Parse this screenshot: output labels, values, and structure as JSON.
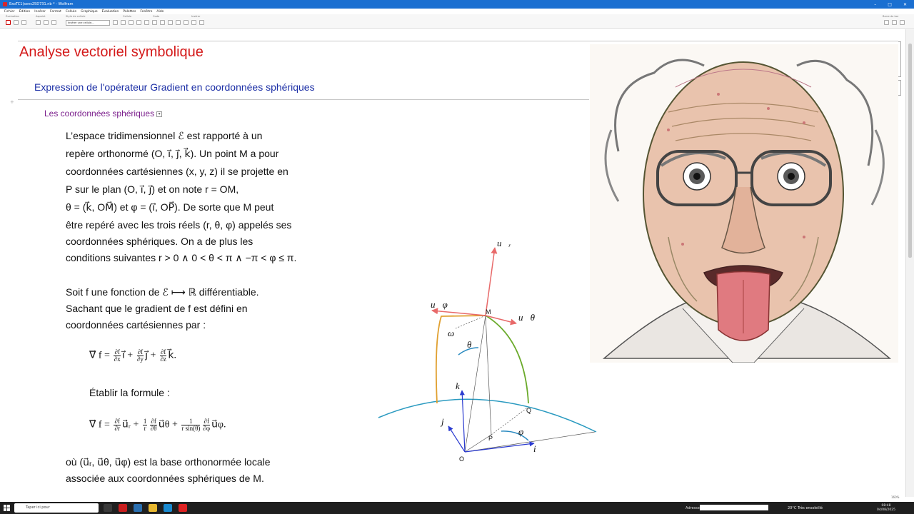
{
  "window": {
    "title": "ExoTC1(sens25D731.nb * - Wolfram",
    "controls": [
      "–",
      "□",
      "✕"
    ]
  },
  "menu": [
    "Fichier",
    "Édition",
    "Insérer",
    "Format",
    "Cellule",
    "Graphique",
    "Évaluation",
    "Palettes",
    "Fenêtre",
    "Aide"
  ],
  "toolbar": {
    "groups": [
      "Évaluation",
      "Aspoint",
      "Style de cellule",
      "Cellule",
      "Code",
      "Insérer"
    ],
    "style_select": "Insérer une cellule...",
    "right_label": "Barre de bor"
  },
  "notebook": {
    "title": "Analyse vectoriel symbolique",
    "section": "Expression de l'opérateur Gradient en coordonnées sphériques",
    "subsection": "Les coordonnées sphériques",
    "para1": [
      "L’espace tridimensionnel ℰ est rapporté à un",
      "repère orthonormé (O, i⃗, j⃗, k⃗). Un point M a pour",
      "coordonnées cartésiennes (x, y, z) il se projette en",
      "P sur le plan (O, i⃗, j⃗) et on note r = OM,",
      "θ = (k⃗, OM⃗) et φ = (i⃗, OP⃗). De sorte que M peut",
      "être repéré avec les trois réels (r, θ, φ) appelés ses",
      "coordonnées sphériques. On a de plus les",
      "conditions suivantes r > 0 ∧ 0 < θ < π ∧ −π < φ ≤ π."
    ],
    "para2": [
      "Soit f une fonction de ℰ ⟼ ℝ différentiable.",
      "Sachant que le gradient de f est défini en",
      "coordonnées cartésiennes par :"
    ],
    "formula1": {
      "lhs": "∇⃗ f = ",
      "t1": "i⃗",
      "t2": "j⃗",
      "t3": "k⃗.",
      "d1": [
        "∂f",
        "∂x"
      ],
      "d2": [
        "∂f",
        "∂y"
      ],
      "d3": [
        "∂f",
        "∂z"
      ]
    },
    "etablir": "Établir la formule :",
    "formula2": {
      "lhs": "∇⃗ f = ",
      "t1": "u⃗ᵣ",
      "t2": "u⃗θ",
      "t3": "u⃗φ.",
      "d1": [
        "∂f",
        "∂r"
      ],
      "c2": [
        "1",
        "r"
      ],
      "d2": [
        "∂f",
        "∂θ"
      ],
      "c3": [
        "1",
        "r sin(θ)"
      ],
      "d3": [
        "∂f",
        "∂φ"
      ]
    },
    "para3": [
      "où (u⃗ᵣ, u⃗θ, u⃗φ) est la base orthonormée locale",
      "associée aux coordonnées sphériques de M."
    ]
  },
  "diagram": {
    "labels": {
      "ur": "u⃗ᵣ",
      "uphi": "u⃗φ",
      "utheta": "u⃗θ",
      "M": "M",
      "omega": "ω",
      "theta": "θ",
      "k": "k⃗",
      "j": "j⃗",
      "Q": "Q",
      "P": "P",
      "phi": "φ",
      "i": "i⃗",
      "O": "O"
    }
  },
  "taskbar": {
    "search": "Taper ici pour",
    "adresse": "Adresse",
    "weather": "20°C Très ensoleillé",
    "time": "08:48",
    "date": "04/08/2025"
  },
  "status": {
    "zoom": "160%"
  },
  "colors": {
    "title": "#d41a1a",
    "section": "#1c2fa6",
    "subsection": "#7b1f8c",
    "titlebar": "#1a6fd1"
  }
}
